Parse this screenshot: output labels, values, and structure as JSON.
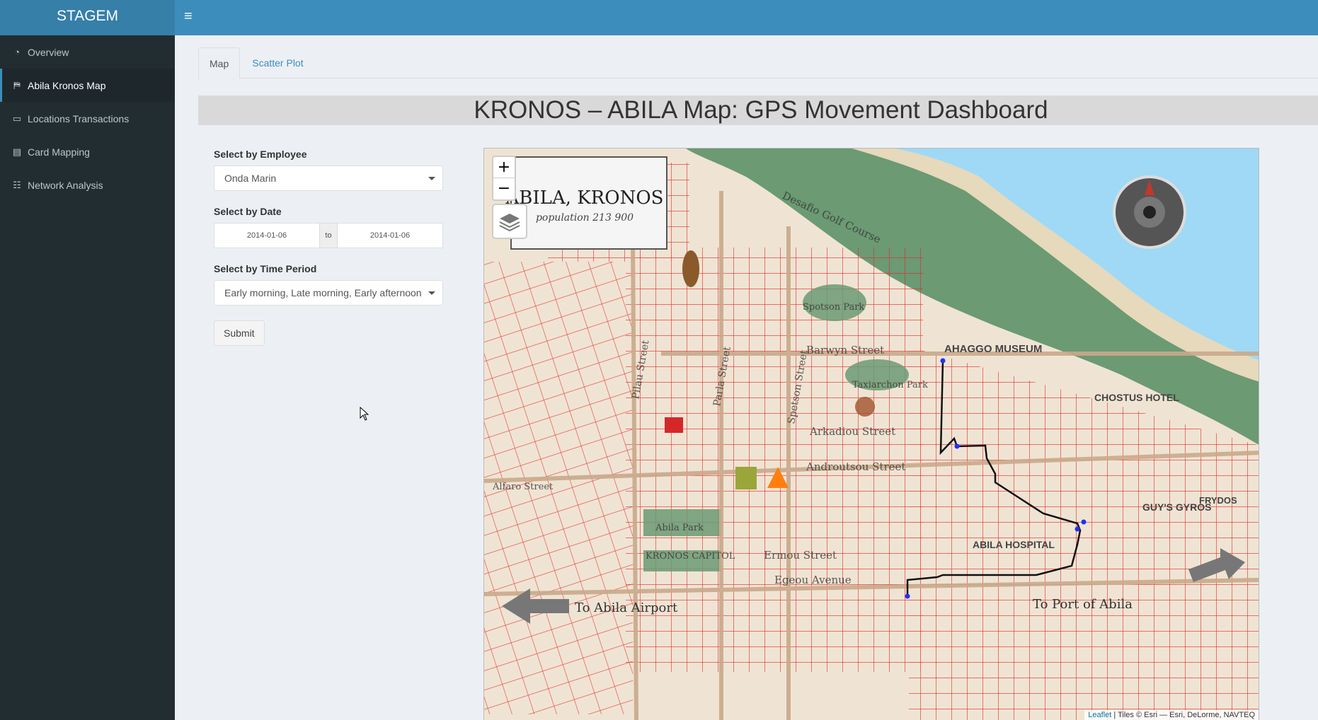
{
  "app": {
    "brand": "STAGEM"
  },
  "header": {
    "toggle_icon": "hamburger-icon"
  },
  "sidebar": {
    "items": [
      {
        "label": "Overview",
        "icon": "dashboard-icon",
        "active": false
      },
      {
        "label": "Abila Kronos Map",
        "icon": "map-marked-icon",
        "active": true
      },
      {
        "label": "Locations Transactions",
        "icon": "money-bill-icon",
        "active": false
      },
      {
        "label": "Card Mapping",
        "icon": "credit-card-icon",
        "active": false
      },
      {
        "label": "Network Analysis",
        "icon": "sitemap-icon",
        "active": false
      }
    ]
  },
  "tabs": [
    {
      "label": "Map",
      "active": true
    },
    {
      "label": "Scatter Plot",
      "active": false
    }
  ],
  "main": {
    "title": "KRONOS – ABILA Map: GPS Movement Dashboard"
  },
  "filters": {
    "employee_label": "Select by Employee",
    "employee_value": "Onda Marin",
    "date_label": "Select by Date",
    "date_start": "2014-01-06",
    "date_sep": "to",
    "date_end": "2014-01-06",
    "period_label": "Select by Time Period",
    "period_value": "Early morning, Late morning, Early afternoon",
    "submit_label": "Submit"
  },
  "map": {
    "zoom_in": "+",
    "zoom_out": "−",
    "attribution_link": "Leaflet",
    "attribution_text": " | Tiles © Esri — Esri, DeLorme, NAVTEQ",
    "city_title": "ABILA, KRONOS",
    "city_subtitle": "population 213 900",
    "labels": {
      "golf": "Desafio Golf Course",
      "pilau": "Pilau Street",
      "parla": "Parla Street",
      "spetson": "Spetson Street",
      "barwyn": "Barwyn Street",
      "arkadiou": "Arkadiou Street",
      "androutsou": "Androutsou Street",
      "ermou": "Ermou Street",
      "egeou": "Egeou Avenue",
      "alfaro": "Alfaro Street",
      "ahaggo": "AHAGGO MUSEUM",
      "chostus": "CHOSTUS HOTEL",
      "hospital": "ABILA HOSPITAL",
      "airport": "To Abila Airport",
      "port": "To Port of Abila",
      "abilapark": "Abila Park",
      "capitol": "KRONOS CAPITOL",
      "spotson_park": "Spotson Park",
      "taxiarchon": "Taxiarchon Park",
      "guys": "GUY'S GYROS",
      "frydos": "FRYDOS"
    }
  },
  "colors": {
    "accent": "#3c8dbc",
    "sidebar_bg": "#222d32",
    "road": "#e8252b",
    "sea": "#9fd9f5",
    "green": "#6b9a73",
    "land": "#efe4d3"
  }
}
